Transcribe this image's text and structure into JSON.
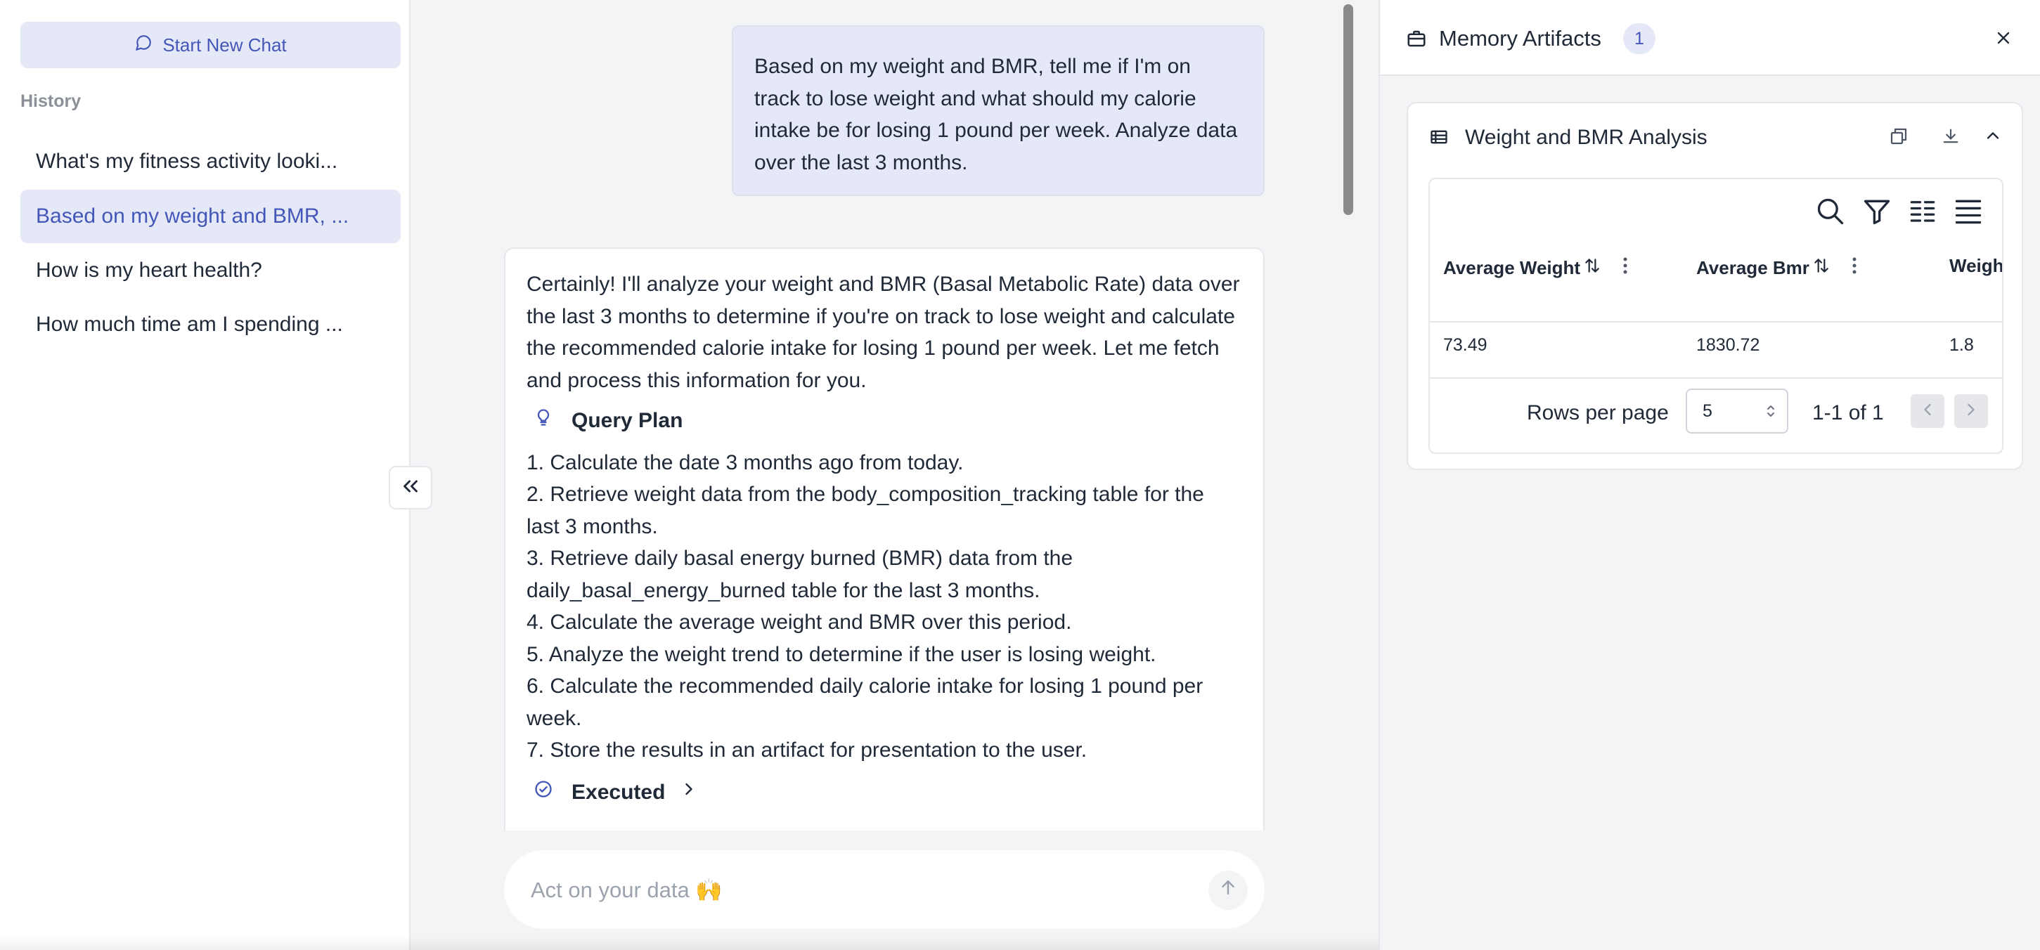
{
  "sidebar": {
    "new_chat_label": "Start New Chat",
    "history_label": "History",
    "items": [
      {
        "label": "What's my fitness activity looki..."
      },
      {
        "label": "Based on my weight and BMR, ..."
      },
      {
        "label": "How is my heart health?"
      },
      {
        "label": "How much time am I spending ..."
      }
    ],
    "active_index": 1
  },
  "chat": {
    "user_message": "Based on my weight and BMR, tell me if I'm on track to lose weight and what should my calorie intake be for losing 1 pound per week. Analyze data over the last 3 months.",
    "assistant_intro": "Certainly! I'll analyze your weight and BMR (Basal Metabolic Rate) data over the last 3 months to determine if you're on track to lose weight and calculate the recommended calorie intake for losing 1 pound per week. Let me fetch and process this information for you.",
    "query_plan_label": "Query Plan",
    "plan_steps": [
      "1. Calculate the date 3 months ago from today.",
      "2. Retrieve weight data from the body_composition_tracking table for the last 3 months.",
      "3. Retrieve daily basal energy burned (BMR) data from the daily_basal_energy_burned table for the last 3 months.",
      "4. Calculate the average weight and BMR over this period.",
      "5. Analyze the weight trend to determine if the user is losing weight.",
      "6. Calculate the recommended daily calorie intake for losing 1 pound per week.",
      "7. Store the results in an artifact for presentation to the user."
    ],
    "executed_label": "Executed",
    "input_placeholder": "Act on your data 🙌"
  },
  "panel": {
    "title": "Memory Artifacts",
    "count": "1",
    "artifact": {
      "title": "Weight and BMR Analysis",
      "columns": [
        "Average Weight",
        "Average Bmr",
        "Weigh"
      ],
      "rows": [
        [
          "73.49",
          "1830.72",
          "1.8"
        ]
      ],
      "rows_per_page_label": "Rows per page",
      "rows_per_page_value": "5",
      "range_label": "1-1 of 1"
    }
  },
  "colors": {
    "accent": "#4457b8",
    "accent_bg": "#e5e9f7"
  }
}
